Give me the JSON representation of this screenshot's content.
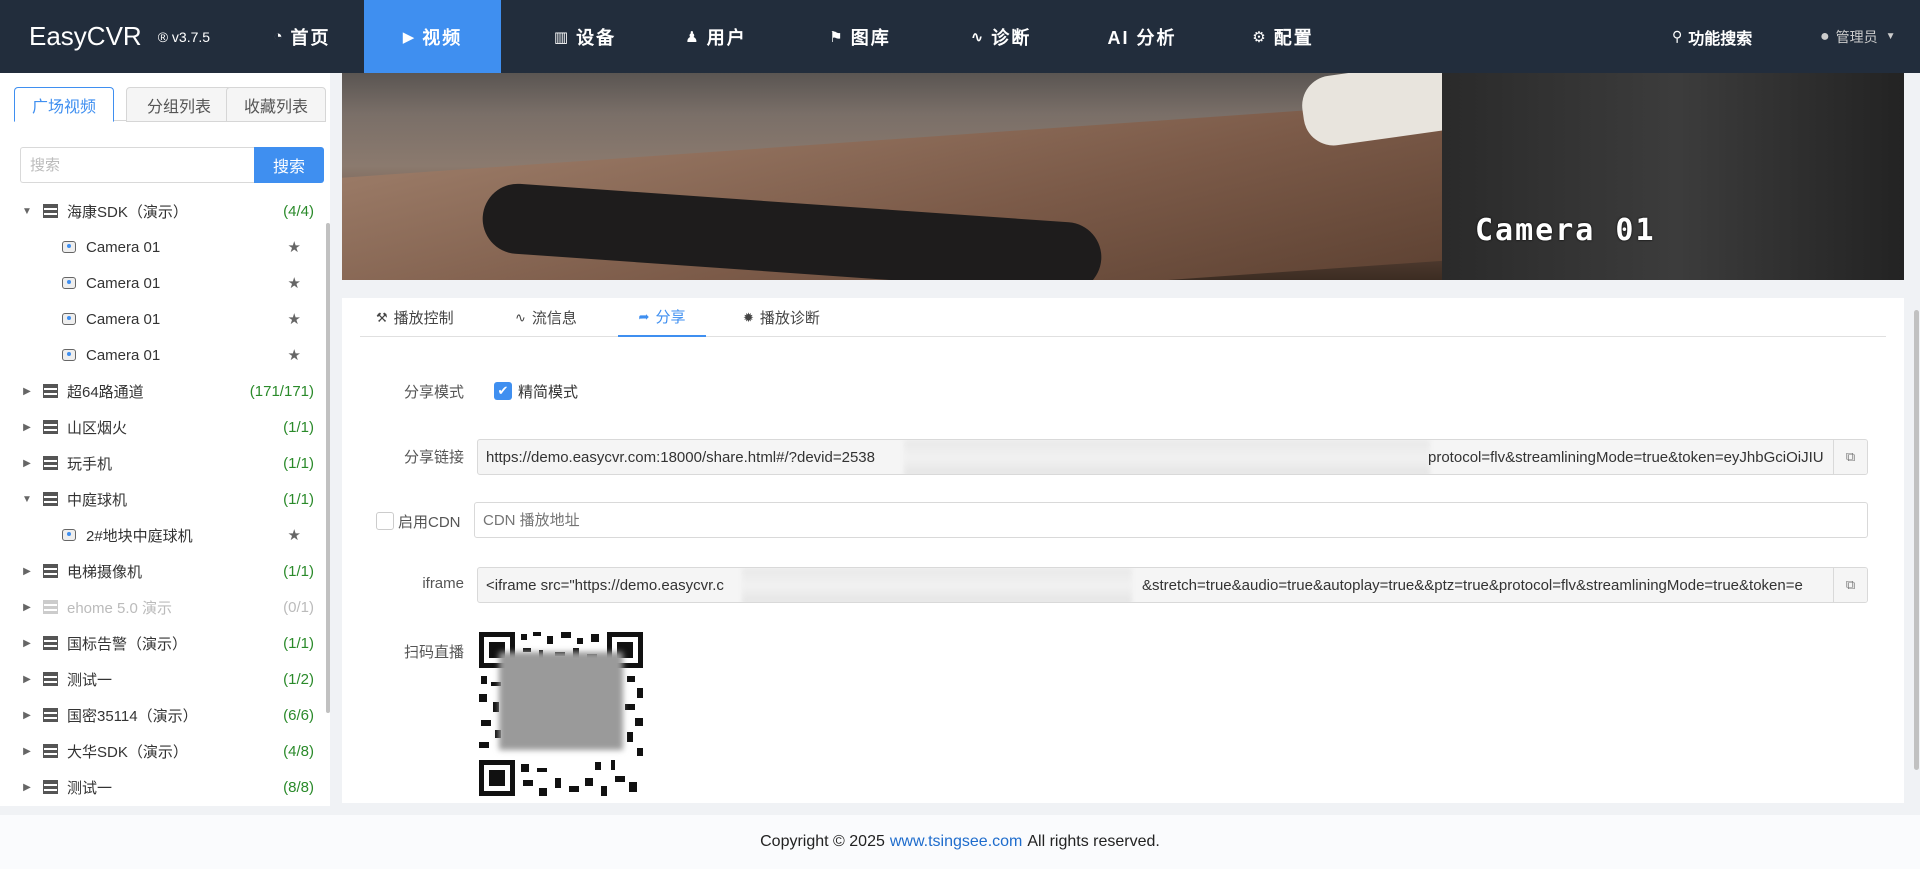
{
  "brand": {
    "name": "EasyCVR",
    "version": "® v3.7.5"
  },
  "nav": {
    "items": [
      {
        "label": "首页",
        "icon": "dashboard-icon"
      },
      {
        "label": "视频",
        "icon": "play-circle-icon",
        "active": true
      },
      {
        "label": "设备",
        "icon": "device-icon"
      },
      {
        "label": "用户",
        "icon": "user-icon"
      },
      {
        "label": "图库",
        "icon": "alarm-icon"
      },
      {
        "label": "诊断",
        "icon": "pulse-icon"
      },
      {
        "label": "AI 分析",
        "icon": ""
      },
      {
        "label": "配置",
        "icon": "gear-icon"
      }
    ],
    "search_label": "功能搜索",
    "user_label": "管理员"
  },
  "sidebar": {
    "tabs": [
      "广场视频",
      "分组列表",
      "收藏列表"
    ],
    "search_placeholder": "搜索",
    "search_button": "搜索",
    "tree": [
      {
        "type": "group",
        "label": "海康SDK（演示）",
        "count": "(4/4)",
        "expanded": true
      },
      {
        "type": "camera",
        "label": "Camera 01"
      },
      {
        "type": "camera",
        "label": "Camera 01"
      },
      {
        "type": "camera",
        "label": "Camera 01"
      },
      {
        "type": "camera",
        "label": "Camera 01"
      },
      {
        "type": "group",
        "label": "超64路通道",
        "count": "(171/171)"
      },
      {
        "type": "group",
        "label": "山区烟火",
        "count": "(1/1)"
      },
      {
        "type": "group",
        "label": "玩手机",
        "count": "(1/1)"
      },
      {
        "type": "group",
        "label": "中庭球机",
        "count": "(1/1)",
        "expanded": true
      },
      {
        "type": "camera",
        "label": "2#地块中庭球机"
      },
      {
        "type": "group",
        "label": "电梯摄像机",
        "count": "(1/1)"
      },
      {
        "type": "group",
        "label": "ehome 5.0 演示",
        "count": "(0/1)",
        "disabled": true
      },
      {
        "type": "group",
        "label": "国标告警（演示）",
        "count": "(1/1)"
      },
      {
        "type": "group",
        "label": "测试一",
        "count": "(1/2)"
      },
      {
        "type": "group",
        "label": "国密35114（演示）",
        "count": "(6/6)"
      },
      {
        "type": "group",
        "label": "大华SDK（演示）",
        "count": "(4/8)"
      },
      {
        "type": "group",
        "label": "测试一",
        "count": "(8/8)"
      }
    ]
  },
  "video": {
    "overlay_text": "Camera 01"
  },
  "panel": {
    "tabs": [
      {
        "label": "播放控制",
        "icon": "wrench-icon"
      },
      {
        "label": "流信息",
        "icon": "pulse-icon"
      },
      {
        "label": "分享",
        "icon": "share-icon",
        "active": true
      },
      {
        "label": "播放诊断",
        "icon": "bug-icon"
      }
    ],
    "share_mode_label": "分享模式",
    "simple_mode_label": "精简模式",
    "share_link_label": "分享链接",
    "share_link_left": "https://demo.easycvr.com:18000/share.html#/?devid=2538",
    "share_link_right": "protocol=flv&streamliningMode=true&token=eyJhbGciOiJIU",
    "cdn_label": "启用CDN",
    "cdn_placeholder": "CDN 播放地址",
    "iframe_label": "iframe",
    "iframe_left": "<iframe src=\"https://demo.easycvr.c",
    "iframe_right": "&stretch=true&audio=true&autoplay=true&&ptz=true&protocol=flv&streamliningMode=true&token=e",
    "qr_label": "扫码直播"
  },
  "footer": {
    "prefix": "Copyright © 2025",
    "link": "www.tsingsee.com",
    "suffix": "All rights reserved."
  },
  "colors": {
    "nav_bg": "#222d3c",
    "accent": "#3f8ff0",
    "count_green": "#2a8a2a"
  }
}
